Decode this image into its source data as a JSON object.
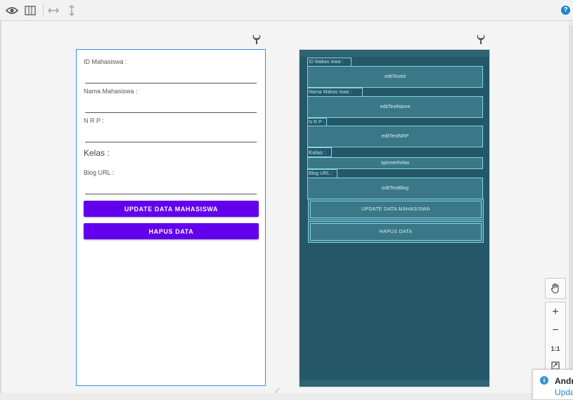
{
  "toolbar": {
    "icons": [
      "eye-icon",
      "columns-icon",
      "horizontal-resize-icon",
      "vertical-resize-icon"
    ],
    "help_glyph": "?"
  },
  "design": {
    "fields": [
      {
        "label": "ID Mahasiswa :"
      },
      {
        "label": "Nama Mahasiswa :"
      },
      {
        "label": "N R P :"
      }
    ],
    "kelas_label": "Kelas :",
    "blog_label": "Blog URL :",
    "update_button": "UPDATE DATA MAHASISWA",
    "delete_button": "HAPUS DATA",
    "accent_color": "#6200ee"
  },
  "blueprint": {
    "label_id": "ID Makas iswa :",
    "field_id": "editTextId",
    "label_nama": "Nama Makas iswa :",
    "field_nama": "editTextName",
    "label_nrp": "N R P :",
    "field_nrp": "editTextNRP",
    "label_kelas": "Kelas :",
    "spinner_kelas": "spinnerKelas",
    "label_blog": "Blog URL :",
    "field_blog": "editTextBlog",
    "update_button": "UPDATE DATA MAHASISWA",
    "delete_button": "HAPUS DATA",
    "background_color": "#245868"
  },
  "zoom": {
    "zoom_in": "+",
    "zoom_out": "−",
    "actual_size": "1:1"
  },
  "notification": {
    "title": "Andr",
    "link": "Upda"
  }
}
